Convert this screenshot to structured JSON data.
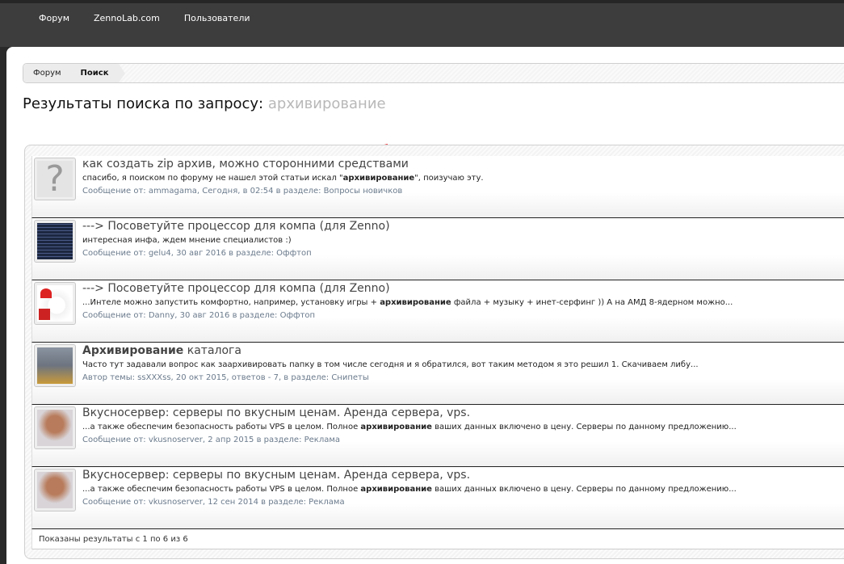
{
  "nav": [
    "Форум",
    "ZennoLab.com",
    "Пользователи"
  ],
  "breadcrumb": [
    "Форум",
    "Поиск"
  ],
  "heading": {
    "prefix": "Результаты поиска по запросу:",
    "query": "архивирование"
  },
  "results": [
    {
      "avatar": "question-mark-avatar",
      "title_bold": "",
      "title": "как создать zip архив, можно сторонними средствами",
      "pre": "спасибо, я поиском по форуму не нашел этой статьи искал \"",
      "bold": "архивирование",
      "post": "\", поизучаю эту.",
      "meta": "Сообщение от: ammagama, Сегодня, в 02:54 в разделе: Вопросы новичков"
    },
    {
      "avatar": "matrix-avatar",
      "title_bold": "",
      "title": "---> Посоветуйте процессор для компа (для Zenno)",
      "pre": "интересная инфа, ждем мнение специалистов :)",
      "bold": "",
      "post": "",
      "meta": "Сообщение от: gelu4, 30 авг 2016 в разделе: Оффтоп"
    },
    {
      "avatar": "puppy-avatar",
      "title_bold": "",
      "title": "---> Посоветуйте процессор для компа (для Zenno)",
      "pre": "...Интеле можно запустить комфортно, например, установку игры + ",
      "bold": "архивирование",
      "post": " файла + музыку + инет-серфинг )) А на АМД 8-ядерном можно...",
      "meta": "Сообщение от: Danny, 30 авг 2016 в разделе: Оффтоп"
    },
    {
      "avatar": "cat-avatar",
      "title_bold": "Архивирование",
      "title": " каталога",
      "pre": "Часто тут задавали вопрос как заархивировать папку в том числе сегодня и я обратился, вот таким методом я это решил 1. Скачиваем либу...",
      "bold": "",
      "post": "",
      "meta": "Автор темы: ssXXXss, 20 окт 2015, ответов - 7, в разделе: Снипеты"
    },
    {
      "avatar": "sphynx-cat-avatar",
      "title_bold": "",
      "title": "Вкусносервер: серверы по вкусным ценам. Аренда сервера, vps.",
      "pre": "...а также обеспечим безопасность работы VPS в целом. Полное ",
      "bold": "архивирование",
      "post": " ваших данных включено в цену. Серверы по данному предложению...",
      "meta": "Сообщение от: vkusnoserver, 2 апр 2015 в разделе: Реклама"
    },
    {
      "avatar": "sphynx-cat-avatar",
      "title_bold": "",
      "title": "Вкусносервер: серверы по вкусным ценам. Аренда сервера, vps.",
      "pre": "...а также обеспечим безопасность работы VPS в целом. Полное ",
      "bold": "архивирование",
      "post": " ваших данных включено в цену. Серверы по данному предложению...",
      "meta": "Сообщение от: vkusnoserver, 12 сен 2014 в разделе: Реклама"
    }
  ],
  "footer": "Показаны результаты с 1 по 6 из 6"
}
